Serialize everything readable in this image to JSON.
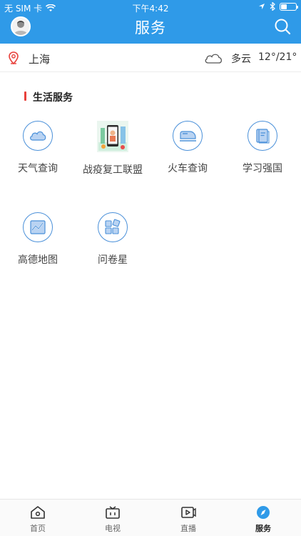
{
  "status": {
    "carrier": "无 SIM 卡",
    "time": "下午4:42"
  },
  "nav": {
    "title": "服务"
  },
  "location": {
    "city": "上海",
    "weather": "多云",
    "temperature": "12°/21°"
  },
  "section": {
    "title": "生活服务"
  },
  "services": [
    {
      "label": "天气查询",
      "icon": "cloud-icon"
    },
    {
      "label": "战疫复工联盟",
      "icon": "alliance-image"
    },
    {
      "label": "火车查询",
      "icon": "train-icon"
    },
    {
      "label": "学习强国",
      "icon": "book-icon"
    },
    {
      "label": "高德地图",
      "icon": "map-icon"
    },
    {
      "label": "问卷星",
      "icon": "survey-icon"
    }
  ],
  "tabs": [
    {
      "label": "首页",
      "icon": "home-icon"
    },
    {
      "label": "电视",
      "icon": "tv-icon"
    },
    {
      "label": "直播",
      "icon": "live-icon"
    },
    {
      "label": "服务",
      "icon": "compass-icon",
      "active": true
    }
  ],
  "colors": {
    "primary": "#2f9ae8",
    "accent": "#e8403b",
    "icon_stroke": "#4a90d9"
  }
}
